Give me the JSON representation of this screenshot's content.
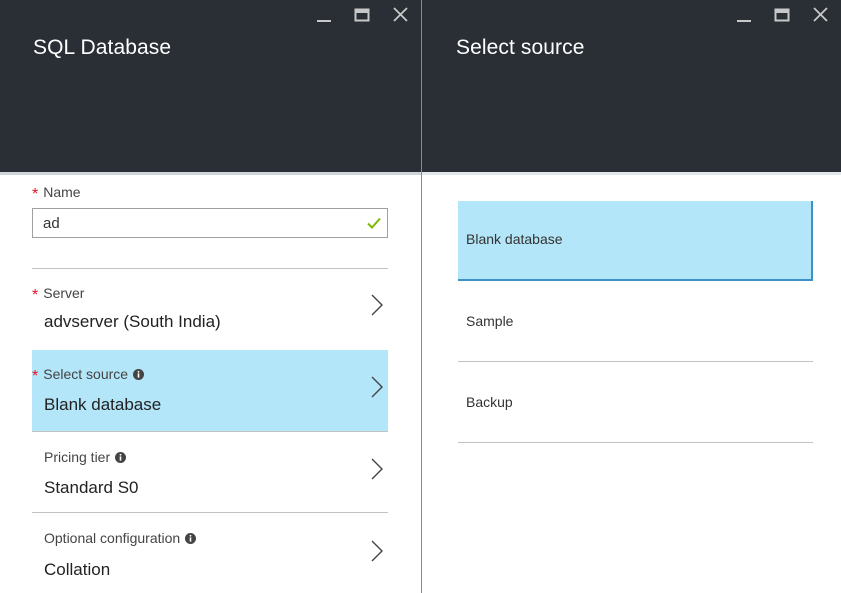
{
  "left_blade": {
    "title": "SQL Database",
    "window_controls": [
      "minimize",
      "maximize",
      "close"
    ],
    "form": {
      "name": {
        "label": "Name",
        "required": true,
        "value": "ad",
        "valid": true
      },
      "rows": [
        {
          "label": "Server",
          "required": true,
          "info": false,
          "value": "advserver (South India)",
          "selected": false
        },
        {
          "label": "Select source",
          "required": true,
          "info": true,
          "value": "Blank database",
          "selected": true
        },
        {
          "label": "Pricing tier",
          "required": false,
          "info": true,
          "value": "Standard S0",
          "selected": false
        },
        {
          "label": "Optional configuration",
          "required": false,
          "info": true,
          "value": "Collation",
          "selected": false
        }
      ]
    }
  },
  "right_blade": {
    "title": "Select source",
    "window_controls": [
      "minimize",
      "maximize",
      "close"
    ],
    "options": [
      {
        "label": "Blank database",
        "selected": true
      },
      {
        "label": "Sample",
        "selected": false
      },
      {
        "label": "Backup",
        "selected": false
      }
    ]
  },
  "colors": {
    "header_bg": "#2a2f35",
    "selected_bg": "#b3e6f8",
    "selected_border": "#3c91c7",
    "required_star": "#e81123",
    "valid_check": "#7fba00"
  },
  "icons": {
    "minimize": "minimize-icon",
    "maximize": "maximize-icon",
    "close": "close-icon",
    "valid": "checkmark-icon",
    "info": "info-icon",
    "chevron": "chevron-right-icon"
  }
}
